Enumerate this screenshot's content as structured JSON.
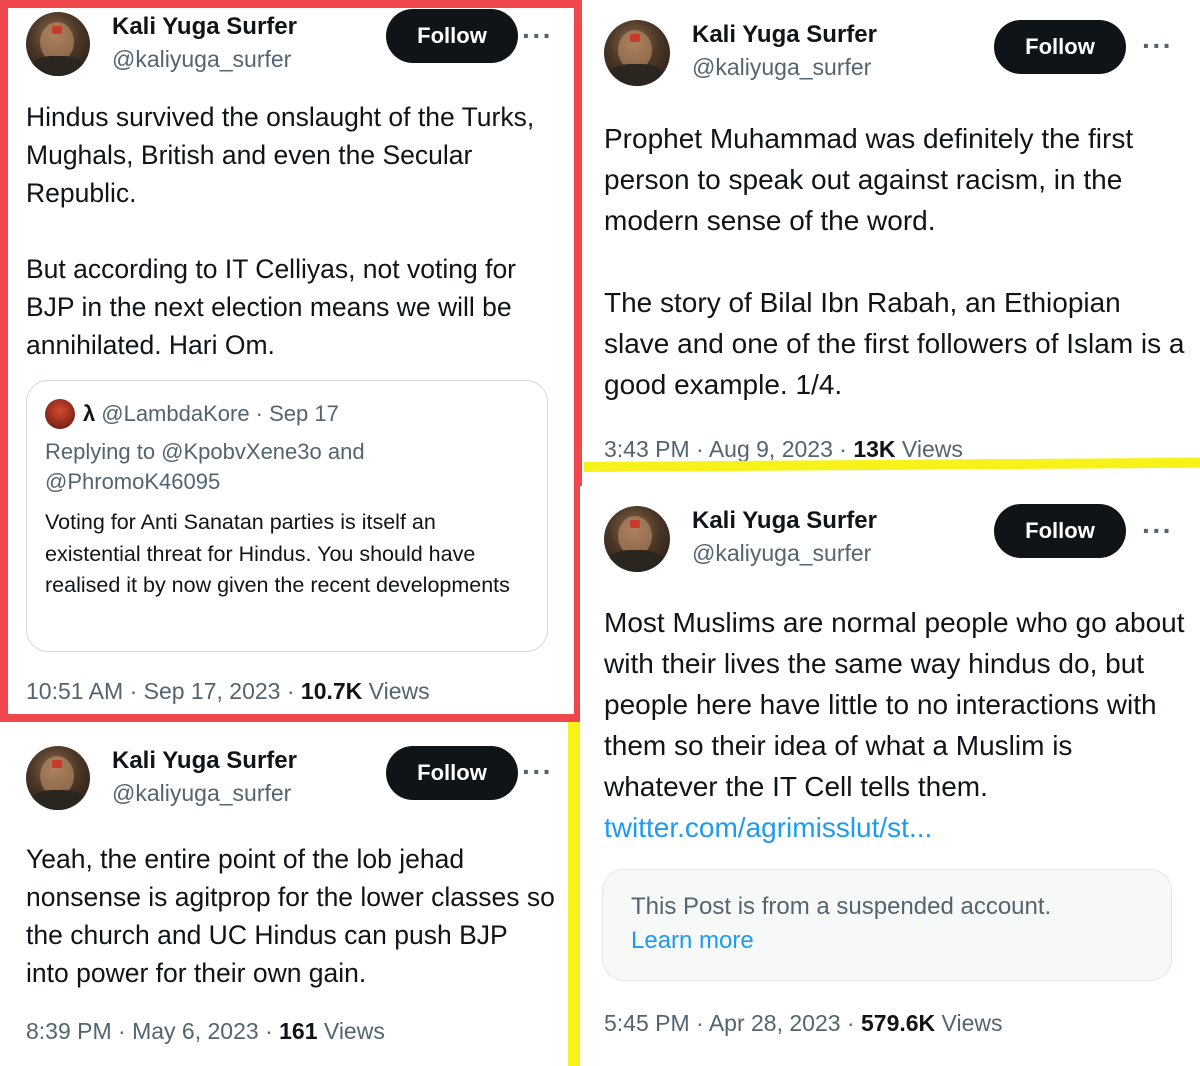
{
  "tweets": [
    {
      "display_name": "Kali Yuga Surfer",
      "handle": "@kaliyuga_surfer",
      "follow_label": "Follow",
      "more": "···",
      "text": "Hindus survived the onslaught of the Turks, Mughals, British and even the Secular Republic.\n\nBut according to IT Celliyas, not voting for BJP in the next election means we will be annihilated. Hari Om.",
      "time": "10:51 AM · Sep 17, 2023 · ",
      "views_count": "10.7K",
      "views_label": " Views",
      "quote": {
        "author_symbol": "λ",
        "author_meta": "@LambdaKore · Sep 17",
        "replying": "Replying to @KpobvXene3o and\n@PhromoK46095",
        "text": "Voting for Anti Sanatan parties is itself an existential threat for Hindus. You should have realised it by now given the recent developments"
      }
    },
    {
      "display_name": "Kali Yuga Surfer",
      "handle": "@kaliyuga_surfer",
      "follow_label": "Follow",
      "more": "···",
      "text": "Yeah, the entire point of the lob jehad nonsense is agitprop for the lower classes so the church and UC Hindus can push BJP into power for their own gain.",
      "time": "8:39 PM · May 6, 2023 · ",
      "views_count": "161",
      "views_label": " Views"
    },
    {
      "display_name": "Kali Yuga Surfer",
      "handle": "@kaliyuga_surfer",
      "follow_label": "Follow",
      "more": "···",
      "text": "Prophet Muhammad was definitely the first person to speak out against racism, in the modern sense of the word.\n\nThe story of Bilal Ibn Rabah, an Ethiopian slave and one of the first followers of Islam is a good example. 1/4.",
      "time": "3:43 PM · Aug 9, 2023 · ",
      "views_count": "13K",
      "views_label": " Views"
    },
    {
      "display_name": "Kali Yuga Surfer",
      "handle": "@kaliyuga_surfer",
      "follow_label": "Follow",
      "more": "···",
      "text": "Most Muslims are normal people who go about with their lives the same way hindus do, but people here have little to no interactions with them so their idea of what a Muslim is whatever the IT Cell tells them. ",
      "link": "twitter.com/agrimisslut/st...",
      "suspended_text": "This Post is from a suspended account.",
      "suspended_link": "Learn more",
      "time": "5:45 PM · Apr 28, 2023 · ",
      "views_count": "579.6K",
      "views_label": " Views"
    }
  ],
  "colors": {
    "highlight_red": "#f0474d",
    "highlight_yellow": "#f7f21a",
    "follow_bg": "#0f1419",
    "link": "#1d9bf0"
  }
}
